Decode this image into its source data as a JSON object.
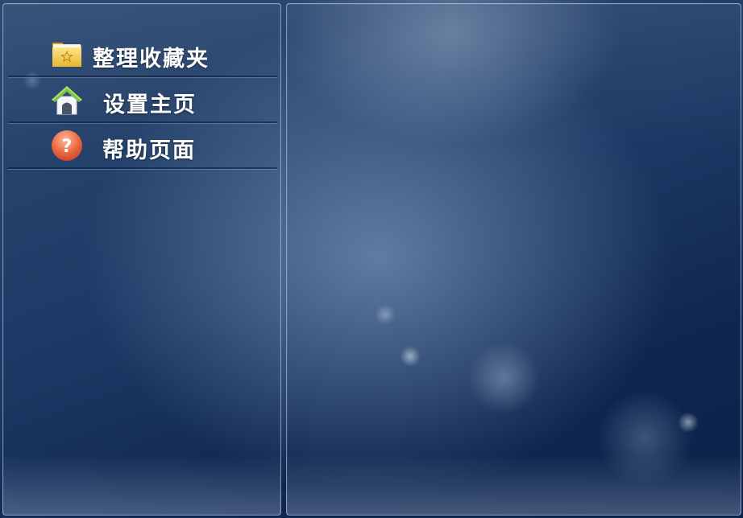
{
  "menu": {
    "items": [
      {
        "label": "整理收藏夹",
        "icon": "folder-star-icon"
      },
      {
        "label": "设置主页",
        "icon": "home-icon"
      },
      {
        "label": "帮助页面",
        "icon": "help-icon"
      }
    ]
  },
  "colors": {
    "background": "#1d3a66",
    "text": "#ffffff",
    "folder": "#f2c94c",
    "home_roof": "#7cc142",
    "help": "#e05a3a"
  }
}
